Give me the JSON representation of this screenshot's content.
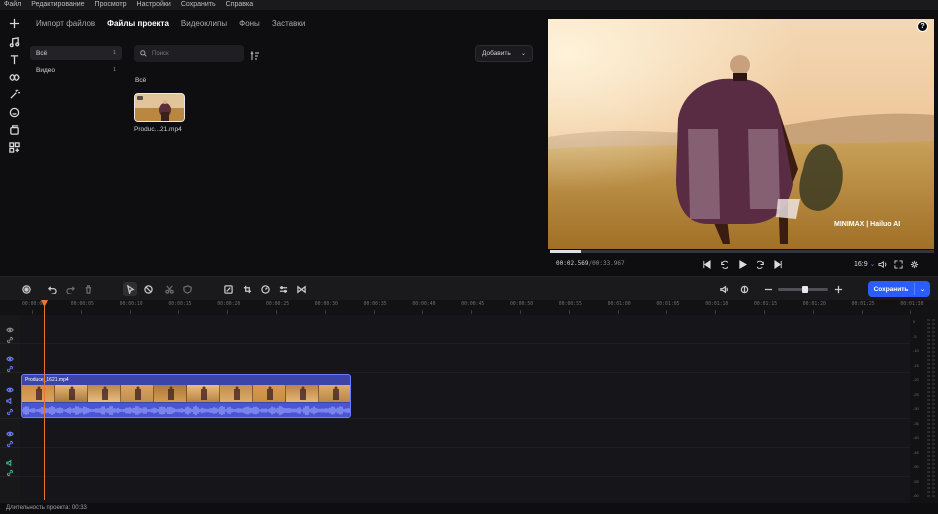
{
  "menu": [
    "Файл",
    "Редактирование",
    "Просмотр",
    "Настройки",
    "Сохранить",
    "Справка"
  ],
  "left_tools": [
    "plus-icon",
    "music-icon",
    "text-icon",
    "transition-icon",
    "effects-icon",
    "sticker-icon",
    "overlay-icon",
    "apps-icon"
  ],
  "media": {
    "tabs": [
      {
        "label": "Импорт файлов",
        "active": false
      },
      {
        "label": "Файлы проекта",
        "active": true
      },
      {
        "label": "Видеоклипы",
        "active": false
      },
      {
        "label": "Фоны",
        "active": false
      },
      {
        "label": "Заставки",
        "active": false
      }
    ],
    "categories": [
      {
        "label": "Всё",
        "count": "1",
        "active": true
      },
      {
        "label": "Видео",
        "count": "1",
        "active": false
      }
    ],
    "search_placeholder": "Поиск",
    "add_label": "Добавить",
    "group_label": "Всё",
    "file_name": "Produc...21.mp4"
  },
  "preview": {
    "help": "?",
    "watermark": "MINIMAX | Hailuo AI",
    "time_current": "00:02.569",
    "time_total": "/00:33.967",
    "progress": 0.08,
    "aspect_ratio": "16:9",
    "aspect_arrow": "⌄"
  },
  "timeline": {
    "save_label": "Сохранить",
    "zoom_level": 0.55,
    "ruler": [
      "00:00:00",
      "00:00:05",
      "00:00:10",
      "00:00:15",
      "00:00:20",
      "00:00:25",
      "00:00:30",
      "00:00:35",
      "00:00:40",
      "00:00:45",
      "00:00:50",
      "00:00:55",
      "00:01:00",
      "00:01:05",
      "00:01:10",
      "00:01:15",
      "00:01:20",
      "00:01:25",
      "00:01:30"
    ],
    "clip_name": "Produce_1621.mp4",
    "meter_labels": [
      "0",
      "-5",
      "-10",
      "-15",
      "-20",
      "-25",
      "-30",
      "-35",
      "-40",
      "-45",
      "-50",
      "-55",
      "-60"
    ]
  },
  "status": {
    "duration": "Длительность проекта: 00:33"
  },
  "colors": {
    "accent": "#2c5cff",
    "playhead": "#e8762c",
    "clip": "#3d44a8"
  }
}
